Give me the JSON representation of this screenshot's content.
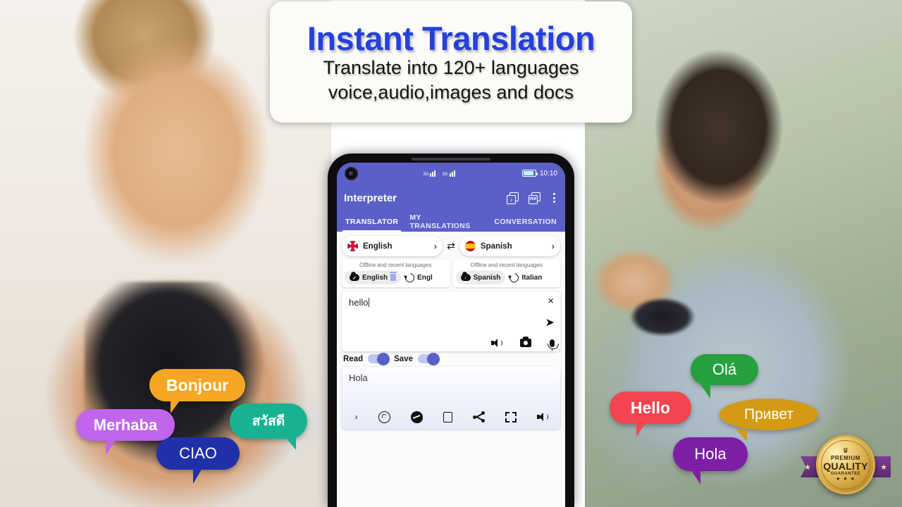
{
  "banner": {
    "title": "Instant Translation",
    "subtitle_line1": "Translate into 120+ languages",
    "subtitle_line2": "voice,audio,images and docs",
    "title_color": "#2540db"
  },
  "phone": {
    "status_bar": {
      "network": "3G 3G",
      "time": "10:10",
      "battery": "85%"
    },
    "app_bar": {
      "title": "Interpreter",
      "audio_files_icon": "audio-files-icon",
      "pdf_files_icon": "pdf-files-icon",
      "pdf_label": "PDF",
      "music_label": "♪",
      "overflow_icon": "overflow-menu-icon"
    },
    "tabs": [
      {
        "label": "TRANSLATOR",
        "active": true
      },
      {
        "label": "MY TRANSLATIONS",
        "active": false
      },
      {
        "label": "CONVERSATION",
        "active": false
      }
    ],
    "source_language": {
      "name": "English",
      "flag": "uk-flag-icon",
      "chevron": "›"
    },
    "target_language": {
      "name": "Spanish",
      "flag": "spain-flag-icon",
      "chevron": "›"
    },
    "swap_icon": "⇄",
    "offline_source": {
      "label": "Offline and recent languages",
      "chips": [
        {
          "name": "English",
          "icon": "cloud-downloaded-icon",
          "trailing": "delete-icon"
        },
        {
          "name": "Engl",
          "icon": "history-icon"
        }
      ]
    },
    "offline_target": {
      "label": "Offline and recent languages",
      "chips": [
        {
          "name": "Spanish",
          "icon": "cloud-download-icon"
        },
        {
          "name": "Italian",
          "icon": "history-icon"
        }
      ]
    },
    "input": {
      "text": "hello",
      "clear_icon": "×",
      "send_icon": "➤",
      "speak_icon": "speaker-icon",
      "camera_icon": "camera-icon",
      "mic_icon": "microphone-icon"
    },
    "toggles": [
      {
        "label": "Read",
        "on": true
      },
      {
        "label": "Save",
        "on": true
      }
    ],
    "output": {
      "text": "Hola",
      "actions": [
        "prev-arrow",
        "whatsapp-icon",
        "messenger-icon",
        "copy-icon",
        "share-icon",
        "fullscreen-icon",
        "speaker-icon"
      ],
      "prev_arrow": "›"
    },
    "accent_color": "#5b60c8"
  },
  "bubbles_left": [
    {
      "id": "bonjour",
      "text": "Bonjour",
      "color": "#f5a623"
    },
    {
      "id": "merhaba",
      "text": "Merhaba",
      "color": "#c065ec"
    },
    {
      "id": "thai",
      "text": "สวัสดี",
      "color": "#17b391"
    },
    {
      "id": "ciao",
      "text": "CIAO",
      "color": "#2030a8"
    }
  ],
  "bubbles_right": [
    {
      "id": "ola",
      "text": "Olá",
      "color": "#27a03f"
    },
    {
      "id": "hello",
      "text": "Hello",
      "color": "#f4444f"
    },
    {
      "id": "privet",
      "text": "Привет",
      "color": "#d49a13"
    },
    {
      "id": "hola",
      "text": "Hola",
      "color": "#7d1fa5"
    }
  ],
  "badge": {
    "crown": "♛",
    "premium": "PREMIUM",
    "quality": "QUALITY",
    "guarantee": "GUARANTEE",
    "stars": "★ ★ ★",
    "ribbon_star_left": "★",
    "ribbon_star_right": "★"
  }
}
